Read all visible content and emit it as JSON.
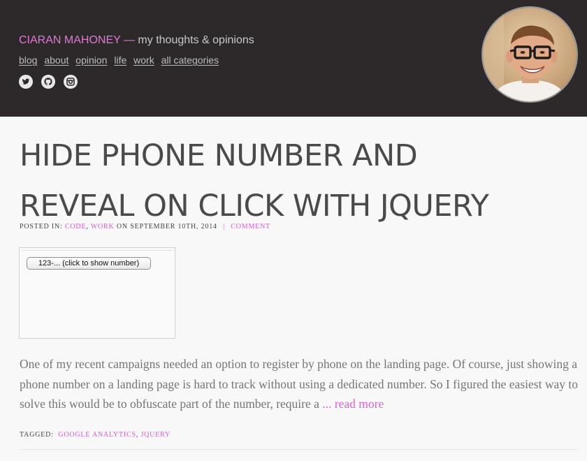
{
  "header": {
    "site_name": "CIARAN MAHONEY",
    "separator": "—",
    "tagline": "my thoughts & opinions",
    "nav": [
      "blog",
      "about",
      "opinion",
      "life",
      "work",
      "all categories"
    ],
    "social_icons": [
      "twitter-icon",
      "github-icon",
      "instagram-icon"
    ]
  },
  "post": {
    "title_line1": "HIDE PHONE NUMBER AND",
    "title_line2": "REVEAL ON CLICK WITH JQUERY",
    "meta": {
      "posted_in_label": "Posted in:",
      "category1": "Code",
      "comma": ",",
      "category2": "Work",
      "date_text": "on September 10th, 2014",
      "pipe": "|",
      "comment_link": "Comment"
    },
    "demo_button_label": "123-... (click to show number)",
    "excerpt": "One of my recent campaigns needed an option to register by phone on the landing page. Of course, just showing a phone number on a landing page is hard to track without using a dedicated number. So I figured the easiest way to solve this would be to obfuscate part of the number, require a",
    "read_more": "... read more",
    "tagged_label": "Tagged:",
    "tag1": "google analytics",
    "tag_comma": ",",
    "tag2": "jquery"
  },
  "colors": {
    "header_bg": "#2d292a",
    "accent": "#e476d8",
    "body_bg": "#f8f8f8"
  }
}
